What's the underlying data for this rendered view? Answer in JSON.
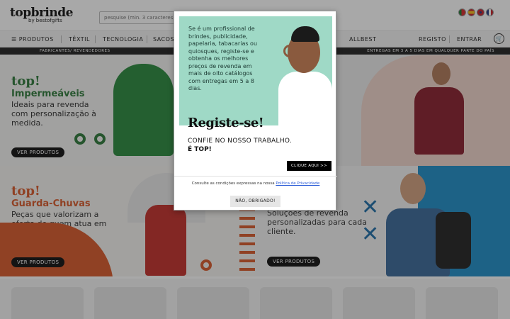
{
  "header": {
    "logo_main": "topbrinde",
    "logo_sub": "by bestofgifts",
    "search_placeholder": "pesquise (min. 3 caracteres)"
  },
  "flags": [
    "pt",
    "es",
    "gb",
    "fr"
  ],
  "nav": {
    "products": "PRODUTOS",
    "items": [
      "TÊXTIL",
      "TECNOLOGIA",
      "SACOS",
      "ALLBEST"
    ],
    "register": "REGISTO",
    "login": "ENTRAR"
  },
  "strip": {
    "left": "FABRICANTES/ REVENDEDORES",
    "right": "ENTREGAS EM 3 A 5 DIAS EM QUALQUER PARTE DO PAÍS"
  },
  "banners": [
    {
      "top": "top!",
      "title": "Impermeáveis",
      "desc": "Ideais para revenda com personalização à medida.",
      "button": "VER PRODUTOS",
      "color": "#2e7a3a"
    },
    {
      "top": "",
      "title": "",
      "desc": "",
      "button": "",
      "color": "#8a1f2e"
    },
    {
      "top": "top!",
      "title": "Guarda-Chuvas",
      "desc": "Peças que valorizam a oferta de quem atua em personalização.",
      "button": "VER PRODUTOS",
      "color": "#d9592a"
    },
    {
      "top": "",
      "title": "",
      "desc": "Soluções de revenda personalizadas para cada cliente.",
      "button": "VER PRODUTOS",
      "color": "#1f6fa8"
    }
  ],
  "modal": {
    "hero_text": "Se é um profissional de brindes, publicidade, papelaria, tabacarias ou quiosques, registe-se e obtenha os melhores preços de revenda em mais de oito catálogos com entregas em 5 a 8 dias.",
    "title": "Registe-se!",
    "subtitle": "CONFIE NO NOSSO TRABALHO.",
    "tagline": "É TOP!",
    "cta": "CLIQUE AQUI >>",
    "consent_text": "Consulte as condições expressas na nossa ",
    "consent_link": "Política de Privacidade",
    "dismiss": "NÃO, OBRIGADO!"
  },
  "colors": {
    "hero_bg": "#9fd9c6",
    "green": "#2e7a3a",
    "orange": "#d9592a",
    "blue": "#1f6fa8",
    "maroon": "#8a1f2e"
  }
}
